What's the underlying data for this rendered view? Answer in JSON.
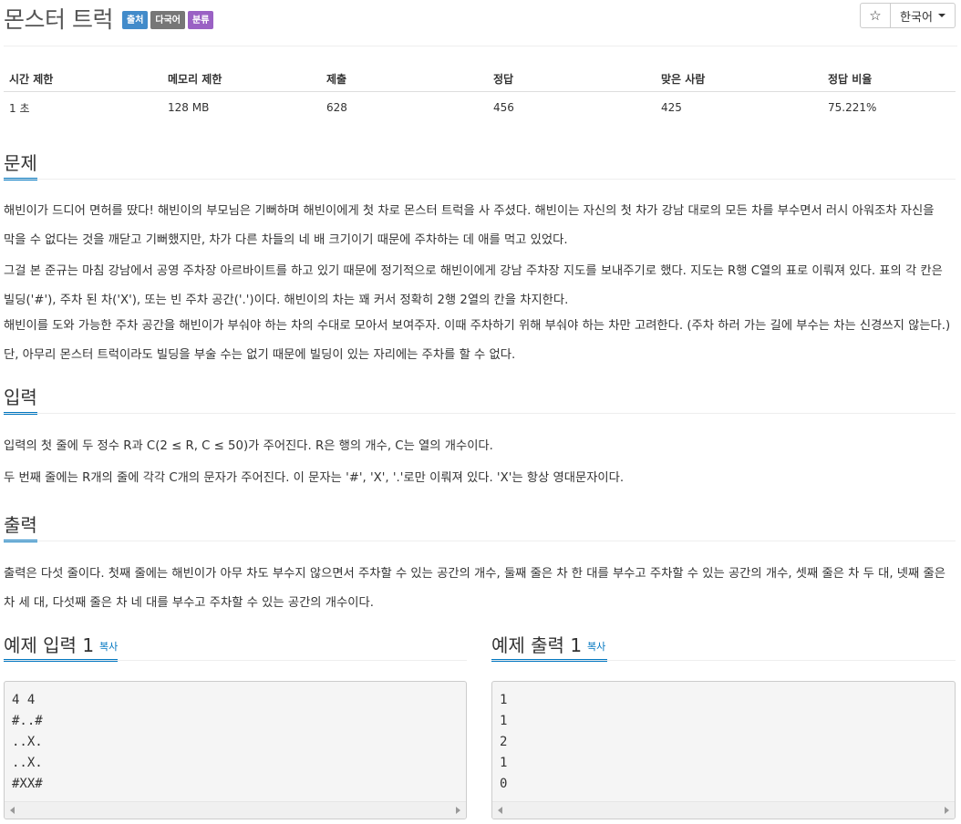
{
  "title": "몬스터 트럭",
  "badges": [
    "출처",
    "다국어",
    "분류"
  ],
  "header": {
    "star": "☆",
    "language": "한국어"
  },
  "info_table": {
    "headers": [
      "시간 제한",
      "메모리 제한",
      "제출",
      "정답",
      "맞은 사람",
      "정답 비율"
    ],
    "values": [
      "1 초",
      "128 MB",
      "628",
      "456",
      "425",
      "75.221%"
    ]
  },
  "problem": {
    "heading": "문제",
    "paragraphs": [
      "해빈이가 드디어 면허를 땄다! 해빈이의 부모님은 기뻐하며 해빈이에게 첫 차로 몬스터 트럭을 사 주셨다. 해빈이는 자신의 첫 차가 강남 대로의 모든 차를 부수면서 러시 아워조차 자신을 막을 수 없다는 것을 깨닫고 기뻐했지만, 차가 다른 차들의 네 배 크기이기 때문에 주차하는 데 애를 먹고 있었다.",
      "그걸 본 준규는 마침 강남에서 공영 주차장 아르바이트를 하고 있기 때문에 정기적으로 해빈이에게 강남 주차장 지도를 보내주기로 했다. 지도는 R행 C열의 표로 이뤄져 있다. 표의 각 칸은 빌딩('#'), 주차 된 차('X'), 또는 빈 주차 공간('.')이다. 해빈이의 차는 꽤 커서 정확히 2행 2열의 칸을 차지한다.",
      "해빈이를 도와 가능한 주차 공간을 해빈이가 부숴야 하는 차의 수대로 모아서 보여주자. 이때 주차하기 위해 부숴야 하는 차만 고려한다. (주차 하러 가는 길에 부수는 차는 신경쓰지 않는다.) 단, 아무리 몬스터 트럭이라도 빌딩을 부술 수는 없기 때문에 빌딩이 있는 자리에는 주차를 할 수 없다."
    ]
  },
  "input": {
    "heading": "입력",
    "paragraphs": [
      "입력의 첫 줄에 두 정수 R과 C(2 ≤ R, C ≤ 50)가 주어진다. R은 행의 개수, C는 열의 개수이다.",
      "두 번째 줄에는 R개의 줄에 각각 C개의 문자가 주어진다. 이 문자는 '#', 'X', '.'로만 이뤄져 있다. 'X'는 항상 영대문자이다."
    ]
  },
  "output": {
    "heading": "출력",
    "paragraphs": [
      "출력은 다섯 줄이다. 첫째 줄에는 해빈이가 아무 차도 부수지 않으면서 주차할 수 있는 공간의 개수, 둘째 줄은 차 한 대를 부수고 주차할 수 있는 공간의 개수, 셋째 줄은 차 두 대, 넷째 줄은 차 세 대, 다섯째 줄은 차 네 대를 부수고 주차할 수 있는 공간의 개수이다."
    ]
  },
  "samples": {
    "copy_label": "복사",
    "input_title": "예제 입력 1",
    "output_title": "예제 출력 1",
    "input_text": "4 4\n#..#\n..X.\n..X.\n#XX#",
    "output_text": "1\n1\n2\n1\n0"
  }
}
